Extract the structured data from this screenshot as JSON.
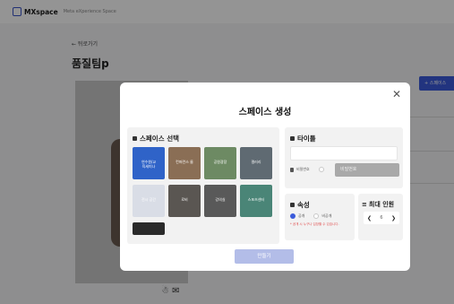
{
  "topbar": {
    "brand": "MXspace",
    "subtitle": "Meta eXperience Space"
  },
  "page": {
    "back_label": "← 뒤로가기",
    "title": "품질팀p",
    "right_button_label": "+ 스페이스"
  },
  "modal": {
    "title": "스페이스 생성",
    "close_glyph": "✕",
    "space_select": {
      "heading": "스페이스 선택",
      "thumbnails": [
        {
          "label": "연수원/교\n육세미나",
          "color": "#2f63c8"
        },
        {
          "label": "컨퍼런스 룸",
          "color": "#8a6e55"
        },
        {
          "label": "공원광장",
          "color": "#6d8a63"
        },
        {
          "label": "갤러리",
          "color": "#5f6a72"
        },
        {
          "label": "전시 공간",
          "color": "#d9dde6"
        },
        {
          "label": "로비",
          "color": "#5a5652"
        },
        {
          "label": "강의실",
          "color": "#595959"
        },
        {
          "label": "스포츠센터",
          "color": "#4a8577"
        },
        {
          "label": "",
          "color": "#2a2a2a"
        }
      ]
    },
    "title_section": {
      "heading": "타이틀",
      "password_label": "비밀번호",
      "password_placeholder": "비밀번호"
    },
    "attribute_section": {
      "heading": "속성",
      "option_public": "공개",
      "option_private": "비공개",
      "note": "* 공개 시 누구나 입장할 수 있습니다."
    },
    "max_section": {
      "heading": "최대 인원",
      "value": "6"
    },
    "create_label": "만들기"
  },
  "colors": {
    "accent": "#3b5bdb",
    "create_disabled": "#b3bde8"
  }
}
